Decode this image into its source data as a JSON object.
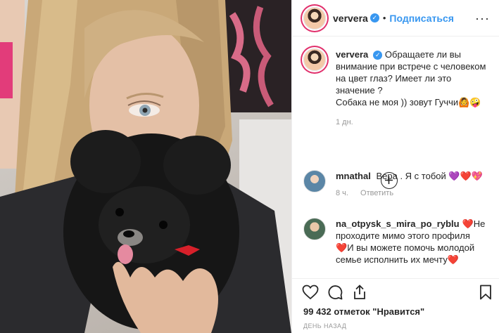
{
  "header": {
    "username": "ververa",
    "separator": "•",
    "follow_label": "Подписаться",
    "more_label": "···"
  },
  "caption": {
    "username": "ververa",
    "text": "Обращаете ли вы внимание при встрече с человеком на цвет глаз? Имеет ли это значение ?",
    "text2": "Собака не моя )) зовут Гуччи",
    "emoji": "🙆🤪",
    "time": "1 дн."
  },
  "comments": [
    {
      "username": "mnathal",
      "text": "Вера . Я с тобой",
      "hearts": "💜❤️💖",
      "time": "8 ч.",
      "reply": "Ответить"
    },
    {
      "username": "na_otpysk_s_mira_po_ryblu",
      "text1": "Не проходите мимо этого профиля",
      "text2": "И вы можете помочь молодой семье исполнить их мечту",
      "heart": "❤️"
    }
  ],
  "likes": "99 432 отметок \"Нравится\"",
  "date": "ДЕНЬ НАЗАД",
  "icons": [
    "verified-badge",
    "heart-icon",
    "comment-icon",
    "share-icon",
    "bookmark-icon",
    "more-icon",
    "add-circle-icon"
  ]
}
